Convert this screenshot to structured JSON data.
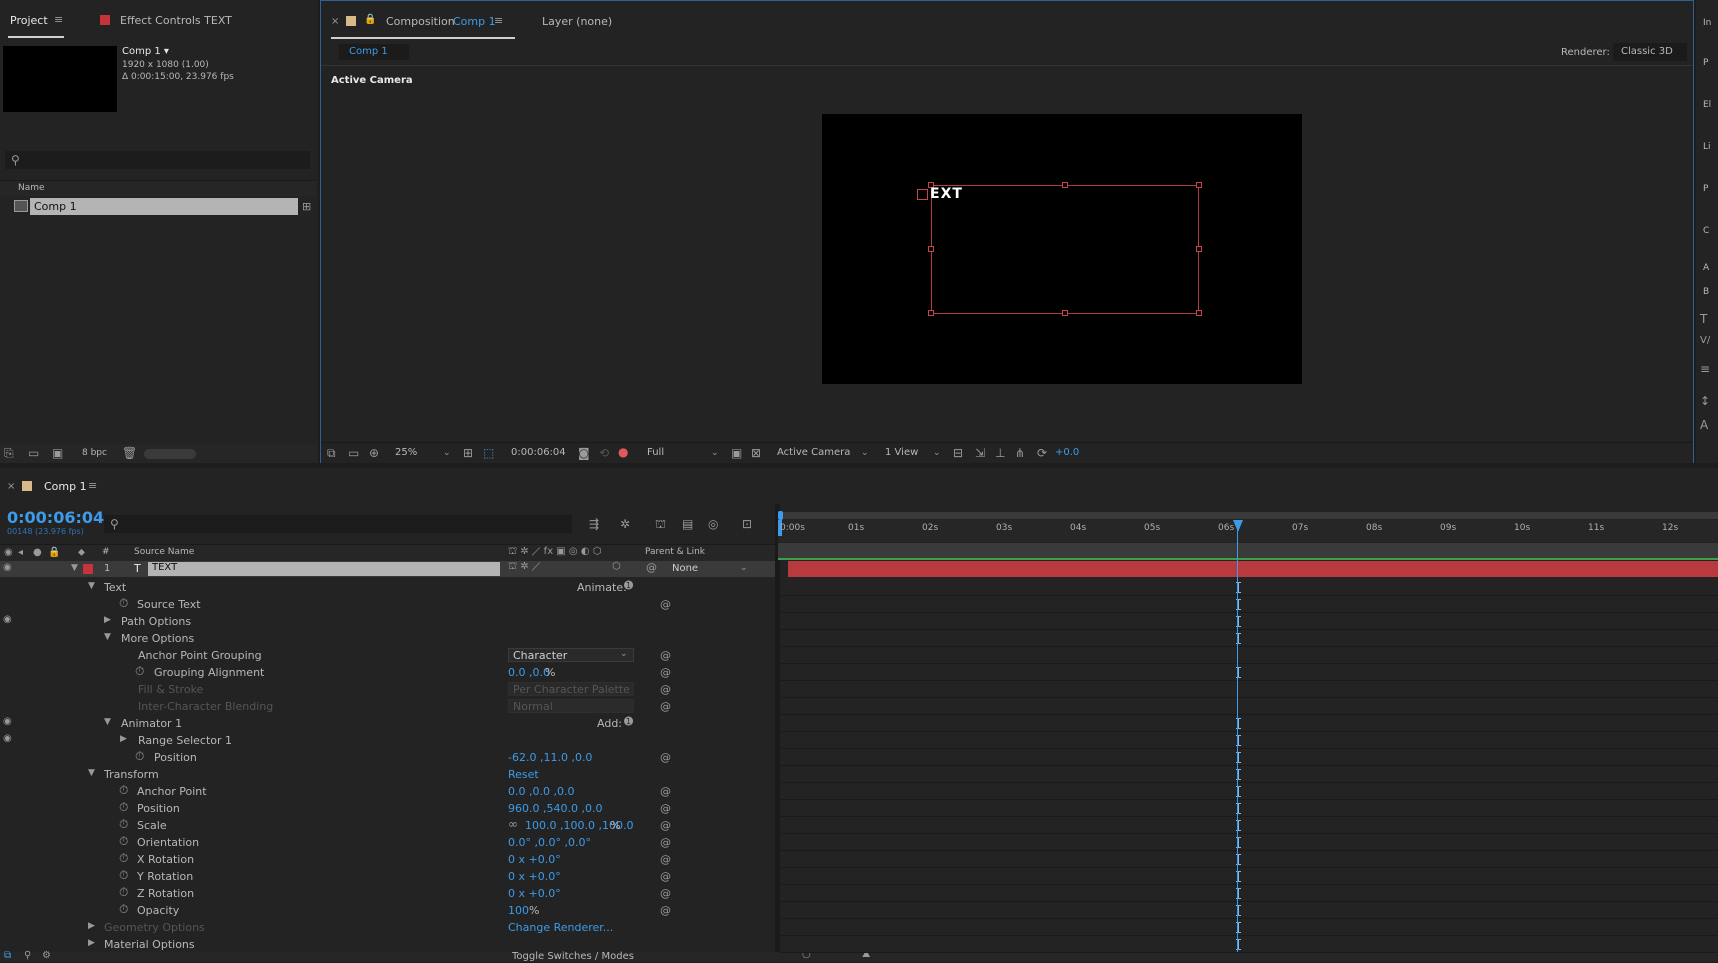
{
  "project": {
    "tab_project": "Project",
    "tab_effect_controls": "Effect Controls TEXT",
    "comp_name": "Comp 1 ▾",
    "comp_res": "1920 x 1080 (1.00)",
    "comp_duration": "Δ 0:00:15:00, 23.976 fps",
    "search_placeholder": "",
    "col_name": "Name",
    "item_name": "Comp 1",
    "bpc": "8 bpc"
  },
  "composition": {
    "tab_label": "Composition",
    "tab_name": "Comp 1",
    "layer_tab": "Layer (none)",
    "subtab": "Comp 1",
    "renderer_label": "Renderer:",
    "renderer_value": "Classic 3D",
    "active_camera": "Active Camera",
    "canvas_text": "EXT",
    "zoom": "25%",
    "time": "0:00:06:04",
    "resolution": "Full",
    "camera": "Active Camera",
    "view": "1 View",
    "exposure": "+0.0"
  },
  "right_panel": {
    "letters": [
      "In",
      "P",
      "El",
      "Li",
      "P",
      "C",
      "A",
      "B"
    ]
  },
  "timeline": {
    "tab": "Comp 1",
    "timecode": "0:00:06:04",
    "frames": "00148 (23.976 fps)",
    "search_placeholder": "",
    "col_hash": "#",
    "col_source": "Source Name",
    "col_parent": "Parent & Link",
    "layer_num": "1",
    "layer_name": "TEXT",
    "parent_value": "None",
    "ruler": [
      "0:00s",
      "01s",
      "02s",
      "03s",
      "04s",
      "05s",
      "06s",
      "07s",
      "08s",
      "09s",
      "10s",
      "11s",
      "12s"
    ],
    "playhead_time_fraction": 0.4913,
    "animate_label": "Animate:",
    "add_label": "Add:",
    "props": {
      "text": "Text",
      "source_text": "Source Text",
      "path_options": "Path Options",
      "more_options": "More Options",
      "anchor_grouping": "Anchor Point Grouping",
      "anchor_grouping_value": "Character",
      "grouping_alignment": "Grouping Alignment",
      "grouping_alignment_value": "0.0 ,0.0",
      "grouping_alignment_unit": "%",
      "fill_stroke": "Fill & Stroke",
      "fill_stroke_value": "Per Character Palette",
      "inter_blending": "Inter-Character Blending",
      "inter_blending_value": "Normal",
      "animator": "Animator 1",
      "range_selector": "Range Selector 1",
      "anim_position": "Position",
      "anim_position_value": "-62.0 ,11.0 ,0.0",
      "transform": "Transform",
      "reset": "Reset",
      "anchor_point": "Anchor Point",
      "anchor_point_value": "0.0 ,0.0 ,0.0",
      "position": "Position",
      "position_value": "960.0 ,540.0 ,0.0",
      "scale": "Scale",
      "scale_value": "100.0 ,100.0 ,100.0",
      "scale_unit": "%",
      "orientation": "Orientation",
      "orientation_value": "0.0° ,0.0° ,0.0°",
      "x_rotation": "X Rotation",
      "x_rotation_value": "0 x +0.0°",
      "y_rotation": "Y Rotation",
      "y_rotation_value": "0 x +0.0°",
      "z_rotation": "Z Rotation",
      "z_rotation_value": "0 x +0.0°",
      "opacity": "Opacity",
      "opacity_value": "100",
      "opacity_unit": "%",
      "geometry_options": "Geometry Options",
      "change_renderer": "Change Renderer...",
      "material_options": "Material Options"
    },
    "toggle_label": "Toggle Switches / Modes"
  }
}
